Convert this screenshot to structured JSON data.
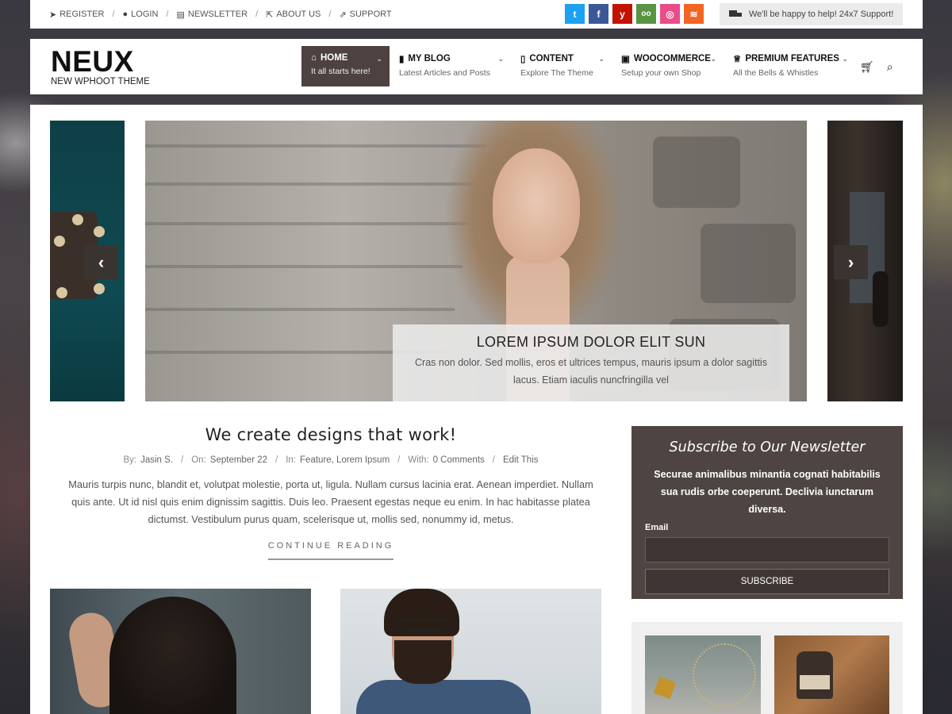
{
  "colors": {
    "accent": "#4d4240",
    "twitter": "#1da1f2",
    "facebook": "#3b5998",
    "yelp": "#c41200",
    "tripadvisor": "#589442",
    "dribbble": "#ea4c89",
    "rss": "#f26522"
  },
  "topbar": {
    "links": [
      {
        "icon": "paper-plane-icon",
        "label": "REGISTER"
      },
      {
        "icon": "user-icon",
        "label": "LOGIN"
      },
      {
        "icon": "newspaper-icon",
        "label": "NEWSLETTER"
      },
      {
        "icon": "external-link-icon",
        "label": "ABOUT US"
      },
      {
        "icon": "share-icon",
        "label": "SUPPORT"
      }
    ],
    "social": [
      {
        "icon": "twitter-icon",
        "glyph": "t"
      },
      {
        "icon": "facebook-icon",
        "glyph": "f"
      },
      {
        "icon": "yelp-icon",
        "glyph": "y"
      },
      {
        "icon": "tripadvisor-icon",
        "glyph": "oo"
      },
      {
        "icon": "dribbble-icon",
        "glyph": "◎"
      },
      {
        "icon": "rss-icon",
        "glyph": "≋"
      }
    ],
    "support_text": "We'll be happy to help! 24x7 Support!"
  },
  "header": {
    "logo": "NEUX",
    "tagline": "NEW WPHOOT THEME",
    "nav": [
      {
        "icon": "home-icon",
        "title": "HOME",
        "subtitle": "It all starts here!",
        "active": true
      },
      {
        "icon": "book-icon",
        "title": "MY BLOG",
        "subtitle": "Latest Articles and Posts"
      },
      {
        "icon": "file-icon",
        "title": "CONTENT",
        "subtitle": "Explore The Theme"
      },
      {
        "icon": "gift-icon",
        "title": "WOOCOMMERCE",
        "subtitle": "Setup your own Shop"
      },
      {
        "icon": "trophy-icon",
        "title": "PREMIUM FEATURES",
        "subtitle": "All the Bells & Whistles"
      }
    ]
  },
  "slider": {
    "title": "LOREM IPSUM DOLOR ELIT SUN",
    "description": "Cras non dolor. Sed mollis, eros et ultrices tempus, mauris ipsum a dolor sagittis lacus. Etiam iaculis nuncfringilla vel"
  },
  "post": {
    "title": "We create designs that work!",
    "meta": {
      "by_label": "By:",
      "author": "Jasin S.",
      "on_label": "On:",
      "date": "September 22",
      "in_label": "In:",
      "categories": "Feature, Lorem Ipsum",
      "with_label": "With:",
      "comments": "0 Comments",
      "edit": "Edit This"
    },
    "excerpt": "Mauris turpis nunc, blandit et, volutpat molestie, porta ut, ligula. Nullam cursus lacinia erat. Aenean imperdiet. Nullam quis ante. Ut id nisl quis enim dignissim sagittis. Duis leo. Praesent egestas neque eu enim. In hac habitasse platea dictumst. Vestibulum purus quam, scelerisque ut, mollis sed, nonummy id, metus.",
    "continue": "CONTINUE READING"
  },
  "newsletter": {
    "title": "Subscribe to Our Newsletter",
    "description": "Securae animalibus minantia cognati habitabilis sua rudis orbe coeperunt. Declivia iunctarum diversa.",
    "email_label": "Email",
    "email_value": "",
    "button": "SUBSCRIBE"
  }
}
